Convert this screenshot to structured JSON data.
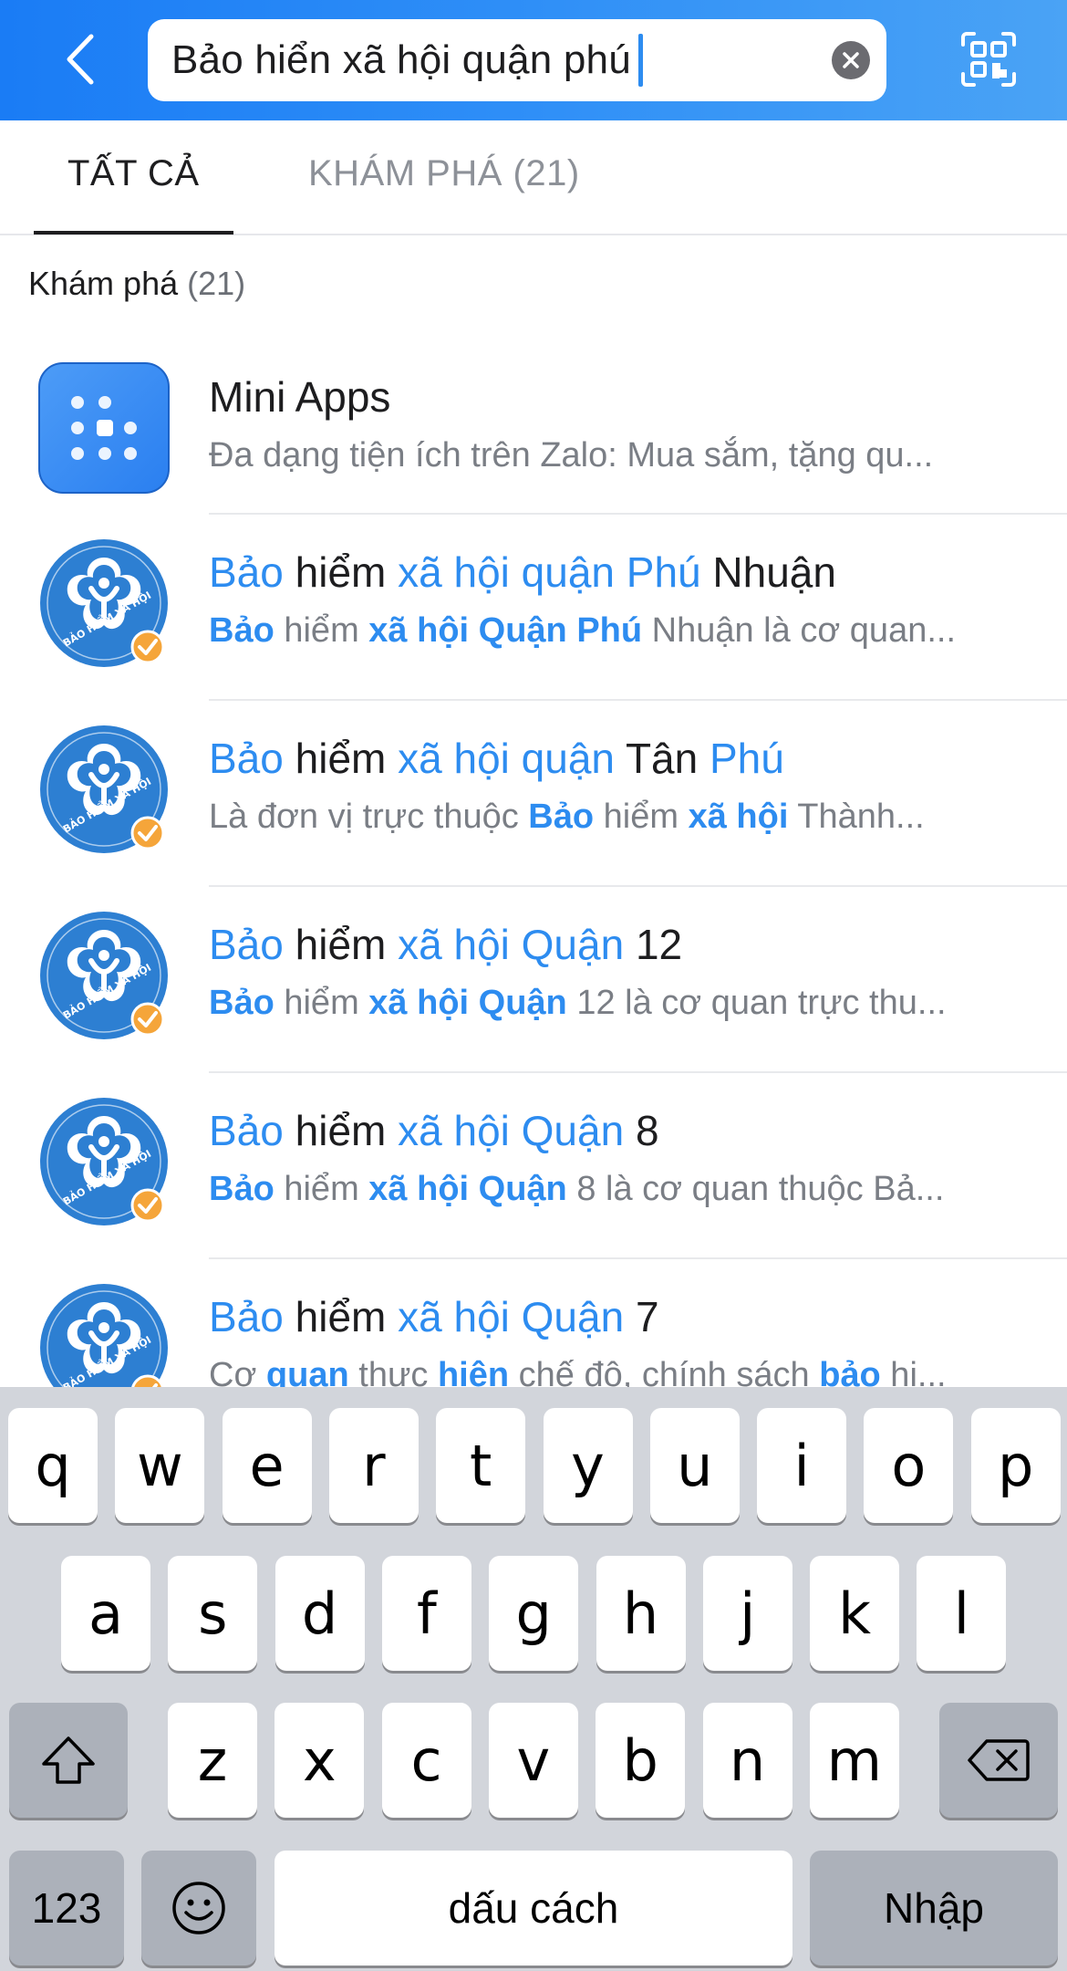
{
  "header": {
    "back_icon": "chevron-left-icon",
    "search_value": "Bảo hiển xã hội quận phú",
    "clear_icon": "clear-circle-icon",
    "qr_icon": "qr-scan-icon"
  },
  "tabs": [
    {
      "label": "TẤT CẢ",
      "active": true
    },
    {
      "label": "KHÁM PHÁ (21)",
      "active": false
    }
  ],
  "section": {
    "title": "Khám phá",
    "count": "(21)"
  },
  "results": [
    {
      "kind": "mini-apps",
      "icon": "mini-apps-grid-icon",
      "title": [
        {
          "t": "Mini Apps",
          "s": "n"
        }
      ],
      "sub": [
        {
          "t": "Đa dạng tiện ích trên Zalo: Mua sắm, tặng qu...",
          "s": "n"
        }
      ]
    },
    {
      "kind": "oa",
      "icon": "social-insurance-logo",
      "title": [
        {
          "t": "Bảo",
          "s": "h"
        },
        {
          "t": " hiểm ",
          "s": "n"
        },
        {
          "t": "xã hội quận Phú",
          "s": "h"
        },
        {
          "t": " Nhuận",
          "s": "n"
        }
      ],
      "sub": [
        {
          "t": "Bảo",
          "s": "b"
        },
        {
          "t": " hiểm ",
          "s": "n"
        },
        {
          "t": "xã hội Quận Phú",
          "s": "b"
        },
        {
          "t": " Nhuận là cơ quan...",
          "s": "n"
        }
      ]
    },
    {
      "kind": "oa",
      "icon": "social-insurance-logo",
      "title": [
        {
          "t": "Bảo",
          "s": "h"
        },
        {
          "t": " hiểm ",
          "s": "n"
        },
        {
          "t": "xã hội quận",
          "s": "h"
        },
        {
          "t": " Tân ",
          "s": "n"
        },
        {
          "t": "Phú",
          "s": "h"
        }
      ],
      "sub": [
        {
          "t": "Là đơn vị trực thuộc ",
          "s": "n"
        },
        {
          "t": "Bảo",
          "s": "b"
        },
        {
          "t": " hiểm ",
          "s": "n"
        },
        {
          "t": "xã hội",
          "s": "b"
        },
        {
          "t": " Thành...",
          "s": "n"
        }
      ]
    },
    {
      "kind": "oa",
      "icon": "social-insurance-logo",
      "title": [
        {
          "t": "Bảo",
          "s": "h"
        },
        {
          "t": " hiểm ",
          "s": "n"
        },
        {
          "t": "xã hội Quận",
          "s": "h"
        },
        {
          "t": " 12",
          "s": "n"
        }
      ],
      "sub": [
        {
          "t": "Bảo",
          "s": "b"
        },
        {
          "t": " hiểm ",
          "s": "n"
        },
        {
          "t": "xã hội Quận",
          "s": "b"
        },
        {
          "t": " 12 là cơ quan trực thu...",
          "s": "n"
        }
      ]
    },
    {
      "kind": "oa",
      "icon": "social-insurance-logo",
      "title": [
        {
          "t": "Bảo",
          "s": "h"
        },
        {
          "t": " hiểm ",
          "s": "n"
        },
        {
          "t": "xã hội Quận",
          "s": "h"
        },
        {
          "t": " 8",
          "s": "n"
        }
      ],
      "sub": [
        {
          "t": "Bảo",
          "s": "b"
        },
        {
          "t": " hiểm ",
          "s": "n"
        },
        {
          "t": "xã hội Quận",
          "s": "b"
        },
        {
          "t": " 8 là cơ quan thuộc Bả...",
          "s": "n"
        }
      ]
    },
    {
      "kind": "oa",
      "icon": "social-insurance-logo",
      "title": [
        {
          "t": "Bảo",
          "s": "h"
        },
        {
          "t": " hiểm ",
          "s": "n"
        },
        {
          "t": "xã hội Quận",
          "s": "h"
        },
        {
          "t": " 7",
          "s": "n"
        }
      ],
      "sub": [
        {
          "t": "Cơ ",
          "s": "n"
        },
        {
          "t": "quan",
          "s": "b"
        },
        {
          "t": " thực ",
          "s": "n"
        },
        {
          "t": "hiện",
          "s": "b"
        },
        {
          "t": " chế độ, chính sách ",
          "s": "n"
        },
        {
          "t": "bảo",
          "s": "b"
        },
        {
          "t": " hi...",
          "s": "n"
        }
      ]
    }
  ],
  "keyboard": {
    "row1": [
      "q",
      "w",
      "e",
      "r",
      "t",
      "y",
      "u",
      "i",
      "o",
      "p"
    ],
    "row2": [
      "a",
      "s",
      "d",
      "f",
      "g",
      "h",
      "j",
      "k",
      "l"
    ],
    "row3": [
      "z",
      "x",
      "c",
      "v",
      "b",
      "n",
      "m"
    ],
    "shift_icon": "shift-icon",
    "delete_icon": "backspace-icon",
    "numbers_label": "123",
    "emoji_icon": "emoji-icon",
    "space_label": "dấu cách",
    "return_label": "Nhập"
  },
  "colors": {
    "header_gradient": [
      "#1a7cf5",
      "#4aa3f5"
    ],
    "highlight": "#2d8cf0",
    "verified_badge": "#f59b2b",
    "logo_blue": "#1f64b4"
  }
}
